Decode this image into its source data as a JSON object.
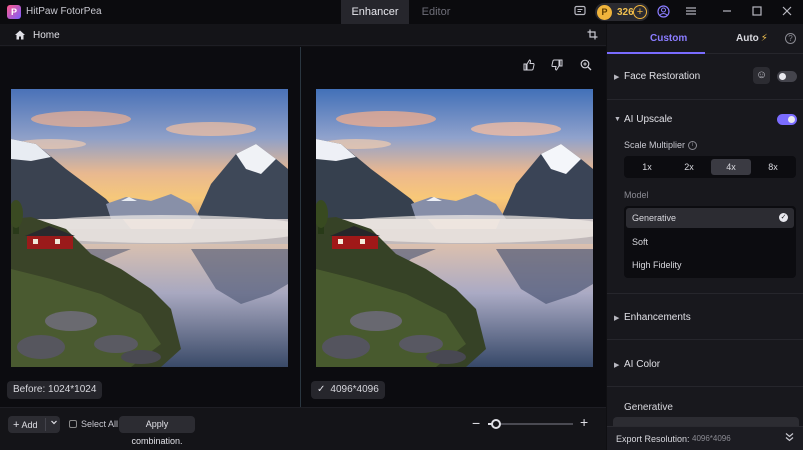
{
  "app": {
    "name": "HitPaw FotorPea"
  },
  "top_tabs": [
    {
      "label": "Enhancer",
      "active": true
    },
    {
      "label": "Editor",
      "active": false
    }
  ],
  "titlebar": {
    "credits": "326",
    "icons": [
      "message-icon",
      "coin-icon",
      "plus-icon",
      "account-icon",
      "menu-icon",
      "minimize-icon",
      "maximize-icon",
      "close-icon"
    ]
  },
  "subheader": {
    "home_label": "Home"
  },
  "canvas": {
    "before_label": "Before: 1024*1024",
    "after_label": "4096*4096",
    "icons": [
      "thumbs-up-icon",
      "thumbs-down-icon",
      "zoom-in-icon"
    ]
  },
  "bottombar": {
    "add_label": "Add",
    "select_all_label": "Select All",
    "apply_label": "Apply combination.",
    "zoom_level": 0.07
  },
  "panel": {
    "tabs": [
      {
        "label": "Custom",
        "active": true
      },
      {
        "label": "Auto",
        "active": false
      }
    ],
    "face_restoration": {
      "title": "Face Restoration",
      "enabled": false
    },
    "ai_upscale": {
      "title": "AI Upscale",
      "enabled": true,
      "scale_label": "Scale Multiplier",
      "scale_options": [
        "1x",
        "2x",
        "4x",
        "8x"
      ],
      "scale_selected": "4x",
      "model_label": "Model",
      "models": [
        "Generative",
        "Soft",
        "High Fidelity"
      ],
      "model_selected": "Generative"
    },
    "enhancements": {
      "title": "Enhancements"
    },
    "ai_color": {
      "title": "AI Color"
    },
    "preset_label": "Generative",
    "export": {
      "label": "Export Resolution:",
      "value": "4096*4096"
    }
  },
  "colors": {
    "accent": "#7a6cff",
    "credit": "#f0b43c"
  }
}
